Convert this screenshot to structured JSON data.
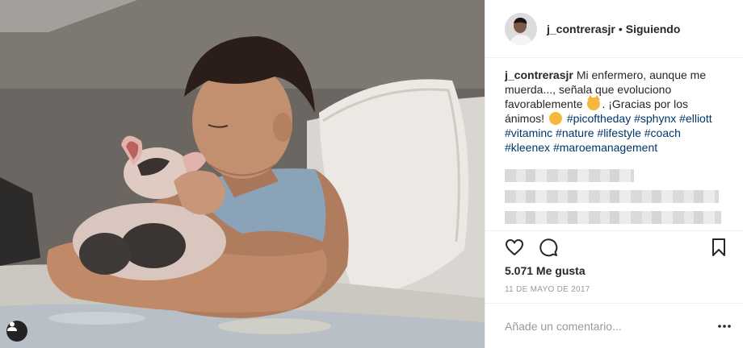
{
  "header": {
    "username": "j_contrerasjr",
    "separator": "•",
    "follow_state": "Siguiendo"
  },
  "caption": {
    "username": "j_contrerasjr",
    "text_1": "Mi enfermero, aunque me muerda..., señala que evoluciono favorablemente",
    "text_2": "¡Gracias por los ánimos!",
    "hashtags": [
      "#picoftheday",
      "#sphynx",
      "#elliott",
      "#vitaminc",
      "#nature",
      "#lifestyle",
      "#coach",
      "#kleenex",
      "#maroemanagement"
    ]
  },
  "icons": {
    "like": "heart-icon",
    "comment": "comment-icon",
    "save": "bookmark-icon",
    "more": "ellipsis-icon",
    "tag": "user-tag-icon",
    "emoji_1": "cat-face-emoji",
    "emoji_2": "smiling-face-emoji"
  },
  "stats": {
    "likes": "5.071 Me gusta",
    "date": "11 DE MAYO DE 2017"
  },
  "comment_box": {
    "placeholder": "Añade un comentario..."
  }
}
